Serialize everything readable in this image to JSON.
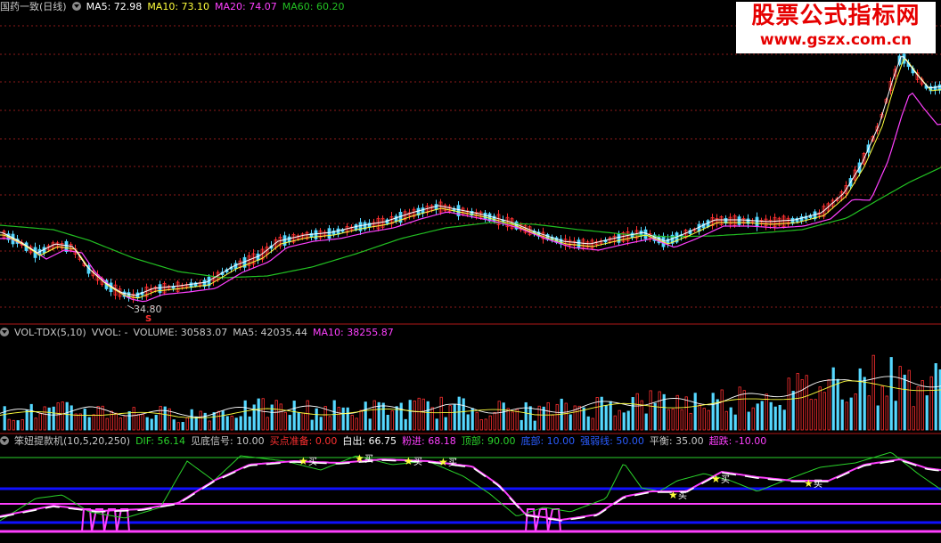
{
  "colors": {
    "background": "#000000",
    "grid": "#8b1a1a",
    "up": "#ff3030",
    "down": "#55d8ff",
    "ma5": "#ffffff",
    "ma10": "#ffff3c",
    "ma20": "#ff40ff",
    "ma60": "#22c022",
    "text_main": "#c8c8c8",
    "vol_label": "#c0c0c0",
    "blue_line": "#1010ff",
    "magenta_line": "#ff40ff",
    "green_line": "#2ad22a"
  },
  "price_panel": {
    "title": "国药一致(日线)",
    "ma5": "MA5: 72.98",
    "ma10": "MA10: 73.10",
    "ma20": "MA20: 74.07",
    "ma60": "MA60: 60.20",
    "low_label": "34.80",
    "low_marker": "S"
  },
  "volume_panel": {
    "name": "VOL-TDX(5,10)",
    "vvol": "VVOL: -",
    "volume": "VOLUME: 30583.07",
    "ma5": "MA5: 42035.44",
    "ma10": "MA10: 38255.87"
  },
  "indicator_panel": {
    "name": "笨妞提款机(10,5,20,250)",
    "dif": "DIF: 56.14",
    "jiandi": "见底信号: 10.00",
    "maidian": "买点准备: 0.00",
    "baichu": "白出: 66.75",
    "fenjin": "粉进: 68.18",
    "dingbu": "顶部: 90.00",
    "dibu": "底部: 10.00",
    "qiangruo": "强弱线: 50.00",
    "pingheng": "平衡: 35.00",
    "chaodie": "超跌: -10.00",
    "buy_label": "买"
  },
  "watermark": {
    "line1": "股票公式指标网",
    "line2": "www.gszx.com.cn"
  },
  "chart_data": {
    "type": "line",
    "title": "国药一致(日线)",
    "series": [
      {
        "name": "MA5",
        "last": 72.98
      },
      {
        "name": "MA10",
        "last": 73.1
      },
      {
        "name": "MA20",
        "last": 74.07
      },
      {
        "name": "MA60",
        "last": 60.2
      }
    ],
    "annotations": [
      {
        "label": "34.80",
        "marker": "S"
      }
    ],
    "indicators": {
      "volume": {
        "VOLUME": 30583.07,
        "MA5": 42035.44,
        "MA10": 38255.87
      },
      "custom": {
        "DIF": 56.14,
        "见底信号": 10.0,
        "买点准备": 0.0,
        "白出": 66.75,
        "粉进": 68.18,
        "顶部": 90.0,
        "底部": 10.0,
        "强弱线": 50.0,
        "平衡": 35.0,
        "超跌": -10.0
      }
    }
  }
}
